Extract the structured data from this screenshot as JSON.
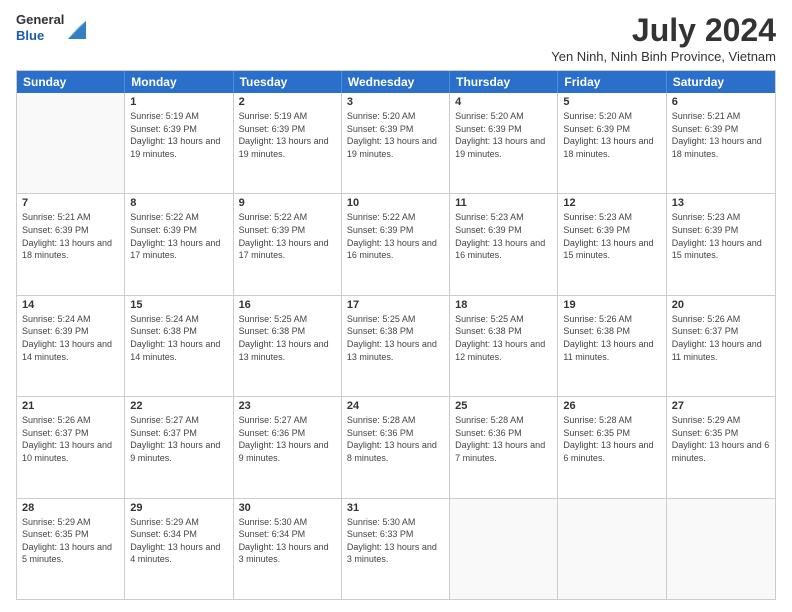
{
  "header": {
    "logo": {
      "line1": "General",
      "line2": "Blue"
    },
    "title": "July 2024",
    "location": "Yen Ninh, Ninh Binh Province, Vietnam"
  },
  "calendar": {
    "days_of_week": [
      "Sunday",
      "Monday",
      "Tuesday",
      "Wednesday",
      "Thursday",
      "Friday",
      "Saturday"
    ],
    "weeks": [
      [
        {
          "day": "",
          "sunrise": "",
          "sunset": "",
          "daylight": ""
        },
        {
          "day": "1",
          "sunrise": "Sunrise: 5:19 AM",
          "sunset": "Sunset: 6:39 PM",
          "daylight": "Daylight: 13 hours and 19 minutes."
        },
        {
          "day": "2",
          "sunrise": "Sunrise: 5:19 AM",
          "sunset": "Sunset: 6:39 PM",
          "daylight": "Daylight: 13 hours and 19 minutes."
        },
        {
          "day": "3",
          "sunrise": "Sunrise: 5:20 AM",
          "sunset": "Sunset: 6:39 PM",
          "daylight": "Daylight: 13 hours and 19 minutes."
        },
        {
          "day": "4",
          "sunrise": "Sunrise: 5:20 AM",
          "sunset": "Sunset: 6:39 PM",
          "daylight": "Daylight: 13 hours and 19 minutes."
        },
        {
          "day": "5",
          "sunrise": "Sunrise: 5:20 AM",
          "sunset": "Sunset: 6:39 PM",
          "daylight": "Daylight: 13 hours and 18 minutes."
        },
        {
          "day": "6",
          "sunrise": "Sunrise: 5:21 AM",
          "sunset": "Sunset: 6:39 PM",
          "daylight": "Daylight: 13 hours and 18 minutes."
        }
      ],
      [
        {
          "day": "7",
          "sunrise": "Sunrise: 5:21 AM",
          "sunset": "Sunset: 6:39 PM",
          "daylight": "Daylight: 13 hours and 18 minutes."
        },
        {
          "day": "8",
          "sunrise": "Sunrise: 5:22 AM",
          "sunset": "Sunset: 6:39 PM",
          "daylight": "Daylight: 13 hours and 17 minutes."
        },
        {
          "day": "9",
          "sunrise": "Sunrise: 5:22 AM",
          "sunset": "Sunset: 6:39 PM",
          "daylight": "Daylight: 13 hours and 17 minutes."
        },
        {
          "day": "10",
          "sunrise": "Sunrise: 5:22 AM",
          "sunset": "Sunset: 6:39 PM",
          "daylight": "Daylight: 13 hours and 16 minutes."
        },
        {
          "day": "11",
          "sunrise": "Sunrise: 5:23 AM",
          "sunset": "Sunset: 6:39 PM",
          "daylight": "Daylight: 13 hours and 16 minutes."
        },
        {
          "day": "12",
          "sunrise": "Sunrise: 5:23 AM",
          "sunset": "Sunset: 6:39 PM",
          "daylight": "Daylight: 13 hours and 15 minutes."
        },
        {
          "day": "13",
          "sunrise": "Sunrise: 5:23 AM",
          "sunset": "Sunset: 6:39 PM",
          "daylight": "Daylight: 13 hours and 15 minutes."
        }
      ],
      [
        {
          "day": "14",
          "sunrise": "Sunrise: 5:24 AM",
          "sunset": "Sunset: 6:39 PM",
          "daylight": "Daylight: 13 hours and 14 minutes."
        },
        {
          "day": "15",
          "sunrise": "Sunrise: 5:24 AM",
          "sunset": "Sunset: 6:38 PM",
          "daylight": "Daylight: 13 hours and 14 minutes."
        },
        {
          "day": "16",
          "sunrise": "Sunrise: 5:25 AM",
          "sunset": "Sunset: 6:38 PM",
          "daylight": "Daylight: 13 hours and 13 minutes."
        },
        {
          "day": "17",
          "sunrise": "Sunrise: 5:25 AM",
          "sunset": "Sunset: 6:38 PM",
          "daylight": "Daylight: 13 hours and 13 minutes."
        },
        {
          "day": "18",
          "sunrise": "Sunrise: 5:25 AM",
          "sunset": "Sunset: 6:38 PM",
          "daylight": "Daylight: 13 hours and 12 minutes."
        },
        {
          "day": "19",
          "sunrise": "Sunrise: 5:26 AM",
          "sunset": "Sunset: 6:38 PM",
          "daylight": "Daylight: 13 hours and 11 minutes."
        },
        {
          "day": "20",
          "sunrise": "Sunrise: 5:26 AM",
          "sunset": "Sunset: 6:37 PM",
          "daylight": "Daylight: 13 hours and 11 minutes."
        }
      ],
      [
        {
          "day": "21",
          "sunrise": "Sunrise: 5:26 AM",
          "sunset": "Sunset: 6:37 PM",
          "daylight": "Daylight: 13 hours and 10 minutes."
        },
        {
          "day": "22",
          "sunrise": "Sunrise: 5:27 AM",
          "sunset": "Sunset: 6:37 PM",
          "daylight": "Daylight: 13 hours and 9 minutes."
        },
        {
          "day": "23",
          "sunrise": "Sunrise: 5:27 AM",
          "sunset": "Sunset: 6:36 PM",
          "daylight": "Daylight: 13 hours and 9 minutes."
        },
        {
          "day": "24",
          "sunrise": "Sunrise: 5:28 AM",
          "sunset": "Sunset: 6:36 PM",
          "daylight": "Daylight: 13 hours and 8 minutes."
        },
        {
          "day": "25",
          "sunrise": "Sunrise: 5:28 AM",
          "sunset": "Sunset: 6:36 PM",
          "daylight": "Daylight: 13 hours and 7 minutes."
        },
        {
          "day": "26",
          "sunrise": "Sunrise: 5:28 AM",
          "sunset": "Sunset: 6:35 PM",
          "daylight": "Daylight: 13 hours and 6 minutes."
        },
        {
          "day": "27",
          "sunrise": "Sunrise: 5:29 AM",
          "sunset": "Sunset: 6:35 PM",
          "daylight": "Daylight: 13 hours and 6 minutes."
        }
      ],
      [
        {
          "day": "28",
          "sunrise": "Sunrise: 5:29 AM",
          "sunset": "Sunset: 6:35 PM",
          "daylight": "Daylight: 13 hours and 5 minutes."
        },
        {
          "day": "29",
          "sunrise": "Sunrise: 5:29 AM",
          "sunset": "Sunset: 6:34 PM",
          "daylight": "Daylight: 13 hours and 4 minutes."
        },
        {
          "day": "30",
          "sunrise": "Sunrise: 5:30 AM",
          "sunset": "Sunset: 6:34 PM",
          "daylight": "Daylight: 13 hours and 3 minutes."
        },
        {
          "day": "31",
          "sunrise": "Sunrise: 5:30 AM",
          "sunset": "Sunset: 6:33 PM",
          "daylight": "Daylight: 13 hours and 3 minutes."
        },
        {
          "day": "",
          "sunrise": "",
          "sunset": "",
          "daylight": ""
        },
        {
          "day": "",
          "sunrise": "",
          "sunset": "",
          "daylight": ""
        },
        {
          "day": "",
          "sunrise": "",
          "sunset": "",
          "daylight": ""
        }
      ]
    ]
  }
}
